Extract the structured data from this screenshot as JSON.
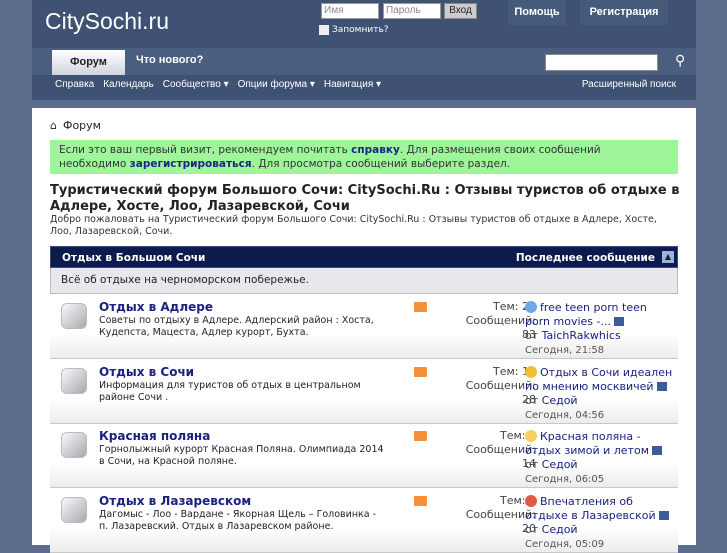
{
  "header": {
    "logo": "CitySochi.ru",
    "username_placeholder": "Имя",
    "password_placeholder": "Пароль",
    "login_button": "Вход",
    "remember": "Запомнить?",
    "help": "Помощь",
    "register": "Регистрация"
  },
  "nav": {
    "tabs": [
      "Форум",
      "Что нового?"
    ],
    "subnav": [
      "Справка",
      "Календарь",
      "Сообщество ▾",
      "Опции форума ▾",
      "Навигация ▾"
    ],
    "advanced_search": "Расширенный поиск"
  },
  "breadcrumb": "Форум",
  "notice": {
    "t1": "Если это ваш первый визит, рекомендуем почитать ",
    "link1": "справку",
    "t2": ". Для размещения своих сообщений необходимо ",
    "link2": "зарегистрироваться",
    "t3": ". Для просмотра сообщений выберите раздел."
  },
  "title": "Туристический форум Большого Сочи: CitySochi.Ru : Отзывы туристов об отдыхе в Адлере, Хосте, Лоо, Лазаревской, Сочи",
  "welcome": "Добро пожаловать на Туристический форум Большого Сочи: CitySochi.Ru : Отзывы туристов об отдыхе в Адлере, Хосте, Лоо, Лазаревской, Сочи.",
  "category": {
    "name": "Отдых в Большом Сочи",
    "last_post_header": "Последнее сообщение",
    "description": "Всё об отдыхе на черноморском побережье."
  },
  "forums": [
    {
      "name": "Отдых в Адлере",
      "desc": "Советы по отдыху в Адлере. Адлерский район : Хоста, Кудепста, Мацеста, Адлер курорт, Бухта.",
      "topics": "Тем: 23",
      "posts_label": "Сообщений:",
      "posts": "83",
      "last_title": "free teen porn teen porn movies -...",
      "by": "от ",
      "author": "TaichRakwhics",
      "date": "Сегодня, 21:58",
      "icon_color": "#6fa8e8"
    },
    {
      "name": "Отдых в Сочи",
      "desc": "Информация для туристов об отдых в центральном районе Сочи .",
      "topics": "Тем: 11",
      "posts_label": "Сообщений:",
      "posts": "28",
      "last_title": "Отдых в Сочи идеален по мнению москвичей",
      "by": "от ",
      "author": "Седой",
      "date": "Сегодня, 04:56",
      "icon_color": "#f0c030"
    },
    {
      "name": "Красная поляна",
      "desc": "Горнолыжный курорт Красная Поляна. Олимпиада 2014 в Сочи, на Красной поляне.",
      "topics": "Тем: 2",
      "posts_label": "Сообщений:",
      "posts": "14",
      "last_title": "Красная поляна - отдых зимой и летом",
      "by": "от ",
      "author": "Седой",
      "date": "Сегодня, 06:05",
      "icon_color": "#f5d060"
    },
    {
      "name": "Отдых в Лазаревском",
      "desc": "Дагомыс - Лоо - Вардане - Якорная Щель – Головинка - п. Лазаревский. Отдых в Лазаревском районе.",
      "topics": "Тем: 5",
      "posts_label": "Сообщений:",
      "posts": "20",
      "last_title": "Впечатления об отдыхе в Лазаревской",
      "by": "от ",
      "author": "Седой",
      "date": "Сегодня, 05:09",
      "icon_color": "#e05a4a"
    }
  ]
}
